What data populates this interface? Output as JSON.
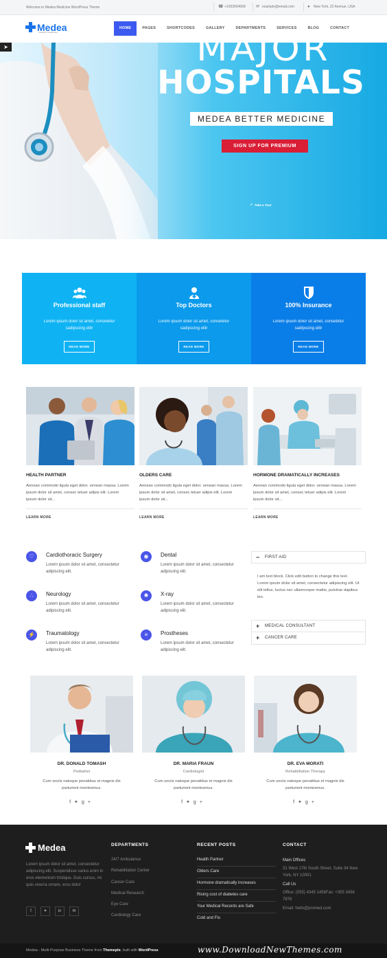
{
  "topbar": {
    "welcome": "Welcome to Medea Medicine WordPress Theme",
    "phone": "+1003654668",
    "email": "example@email.com",
    "address": "New York, 22 Avenue, USA"
  },
  "header": {
    "logo_name": "Medea",
    "logo_tagline": "medical & healthcare",
    "nav": [
      "HOME",
      "PAGES",
      "SHORTCODES",
      "GALLERY",
      "DEPARTMENTS",
      "SERVICES",
      "BLOG",
      "CONTACT"
    ],
    "active_nav": "HOME"
  },
  "hero": {
    "title_light": "MAJOR",
    "title_bold": "HOSPITALS",
    "subtitle": "MEDEA BETTER MEDICINE",
    "cta": "SIGN UP FOR PREMIUM",
    "tour": "Take a Tour"
  },
  "features": [
    {
      "icon": "users-icon",
      "title": "Professional staff",
      "text": "Lorem ipsum dolor sit amet, consetetur sadipscing elitr",
      "button": "READ MORE",
      "color": "#0fb3f4"
    },
    {
      "icon": "doctor-icon",
      "title": "Top Doctors",
      "text": "Lorem ipsum dolor sit amet, consetetur sadipscing elitr",
      "button": "READ MORE",
      "color": "#0b9aec"
    },
    {
      "icon": "shield-icon",
      "title": "100% Insurance",
      "text": "Lorem ipsum dolor sit amet, consetetur sadipscing elitr",
      "button": "READ MORE",
      "color": "#0a7ee8"
    }
  ],
  "cards": [
    {
      "title": "HEALTH PARTNER",
      "text": "Aenean commodo ligula eget dolor. venean massa. Lorem ipsum dolor sit amet, consec tetuer adipis elit. Lorem ipsum dolor sit...",
      "link": "LEARN MORE"
    },
    {
      "title": "OLDERS CARE",
      "text": "Aenean commodo ligula eget dolor. venean massa. Lorem ipsum dolor sit amet, consec tetuer adipis elit. Lorem ipsum dolor sit...",
      "link": "LEARN MORE"
    },
    {
      "title": "HORMONE DRAMATICALLY INCREASES",
      "text": "Aenean commodo ligula eget dolor. venean massa. Lorem ipsum dolor sit amet, consec tetuer adipis elit. Lorem ipsum dolor sit...",
      "link": "LEARN MORE"
    }
  ],
  "services": [
    {
      "icon": "heart-icon",
      "title": "Cardiothoracic Surgery",
      "text": "Lorem ipsum dolor sit amet, consectetur adipiscing elit."
    },
    {
      "icon": "eye-icon",
      "title": "Dental",
      "text": "Lorem ipsum dolor sit amet, consectetur adipiscing elit."
    },
    {
      "icon": "network-icon",
      "title": "Neurology",
      "text": "Lorem ipsum dolor sit amet, consectetur adipiscing elit."
    },
    {
      "icon": "radiation-icon",
      "title": "X-ray",
      "text": "Lorem ipsum dolor sit amet, consectetur adipiscing elit."
    },
    {
      "icon": "bolt-icon",
      "title": "Traumatology",
      "text": "Lorem ipsum dolor sit amet, consectetur adipiscing elit."
    },
    {
      "icon": "bars-icon",
      "title": "Prostheses",
      "text": "Lorem ipsum dolor sit amet, consectetur adipiscing elit."
    }
  ],
  "accordion": {
    "open_title": "FIRST AID",
    "open_text": "I am text block. Click edit button to change this text. Lorem ipsum dolor sit amet, consectetur adipiscing elit. Ut elit tellus, luctus nec ullamcorper mattis, pulvinar dapibus leo.",
    "items": [
      "MEDICAL CONSULTANT",
      "CANCER CARE"
    ]
  },
  "doctors": [
    {
      "name": "DR. DONALD TOMASH",
      "role": "Pediatrist",
      "text": "Cum sociis natoque penatibus et magnis dis parturient montesmus."
    },
    {
      "name": "DR. MARIA FRAUN",
      "role": "Cardiologist",
      "text": "Cum sociis natoque penatibus et magnis dis parturient montesmus."
    },
    {
      "name": "DR. EVA MORATI",
      "role": "Rehabilitation Therapy",
      "text": "Cum sociis natoque penatibus et magnis dis parturient montesmus."
    }
  ],
  "footer": {
    "about": "Lorem ipsum dolor sit amet, consectetur adipiscing elit. Suspendisse varius enim in eros elementum tristique. Duis cursus, mi quis viverra ornare, eros dolor",
    "social": [
      "facebook-icon",
      "twitter-icon",
      "linkedin-icon",
      "mail-icon"
    ],
    "departments_title": "DEPARTMENTS",
    "departments": [
      "24/7 Ambulance",
      "Rehabilitation Center",
      "Cancer Care",
      "Medical Research",
      "Eye Care",
      "Cardiology Care"
    ],
    "posts_title": "RECENT POSTS",
    "posts": [
      "Health Partner",
      "Olders Care",
      "Hormone dramatically increases",
      "Rising cost of diabetes care",
      "Your Medical Records are Safe",
      "Cold and Flu"
    ],
    "contact_title": "CONTACT",
    "office_label": "Main Offices",
    "office_address": "31 West 17th South Street, Suite 34 New York, NY 10001",
    "call_label": "Call Us",
    "phones": "Office: (055) 4345 1456Fax: +355 3456 7876",
    "email": "Email: hello@promed.com"
  },
  "bottom": {
    "copy_prefix": "Medea - Multi-Purpose Business Theme from",
    "author": "Themeple",
    "built": ", built with",
    "platform": "WordPress",
    "watermark": "www.DownloadNewThemes.com"
  }
}
